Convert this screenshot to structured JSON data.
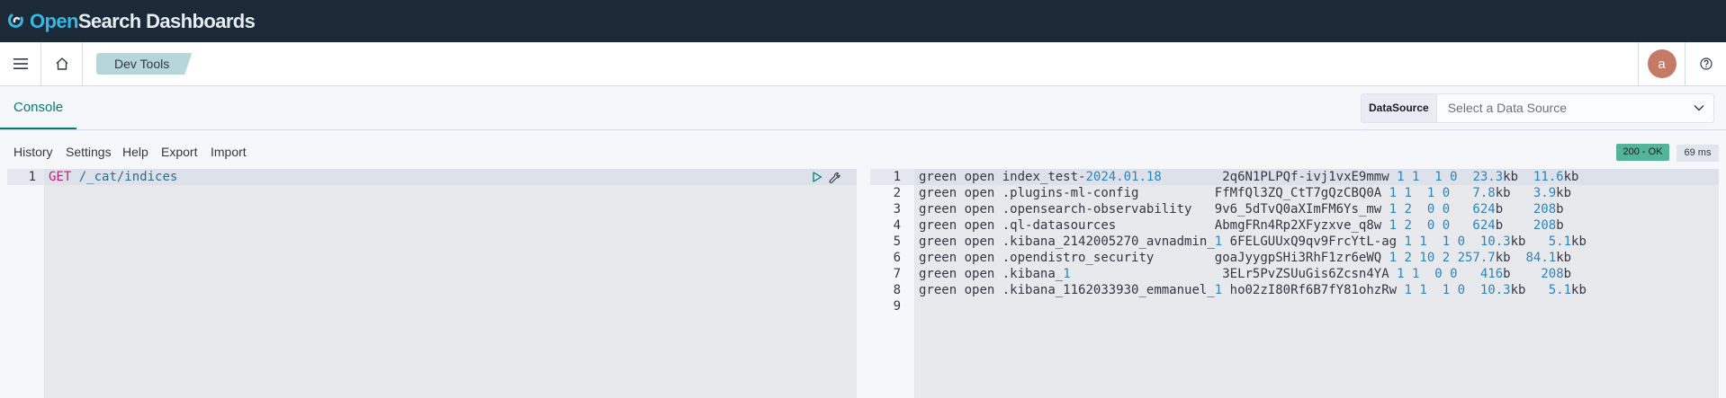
{
  "topbar": {
    "brand_open": "Open",
    "brand_rest": "Search Dashboards",
    "logo_icon": "opensearch-logo-icon"
  },
  "header": {
    "menu_icon": "hamburger-menu-icon",
    "home_icon": "home-icon",
    "breadcrumb": "Dev Tools",
    "avatar_initial": "a",
    "help_icon": "help-icon"
  },
  "console": {
    "tab_label": "Console",
    "datasource_label": "DataSource",
    "datasource_placeholder": "Select a Data Source",
    "menu": [
      "History",
      "Settings",
      "Help",
      "Export",
      "Import"
    ],
    "status_badge": "200 - OK",
    "time_badge": "69 ms",
    "status_color": "#54b399"
  },
  "request": {
    "lines": [
      {
        "num": "1",
        "method": "GET",
        "path": "/_cat/indices"
      }
    ],
    "run_icon": "play-icon",
    "settings_icon": "wrench-icon"
  },
  "response": {
    "line_numbers": [
      "1",
      "2",
      "3",
      "4",
      "5",
      "6",
      "7",
      "8",
      "9"
    ],
    "rows": [
      {
        "health": "green",
        "status": "open",
        "index": "index_test-",
        "index_num": "2024.01.18",
        "pad": "       ",
        "uuid": "2q6N1PLPQf-ivj1vxE9mmw",
        "pri": "1",
        "rep": "1",
        "docs": " 1",
        "del": "0",
        "size_a": " 23.3",
        "size_a_u": "kb",
        "size_b": " 11.6",
        "size_b_u": "kb"
      },
      {
        "health": "green",
        "status": "open",
        "index": ".plugins-ml-config",
        "index_num": "",
        "pad": "         ",
        "uuid": "FfMfQl3ZQ_CtT7gQzCBQ0A",
        "pri": "1",
        "rep": "1",
        "docs": " 1",
        "del": "0",
        "size_a": "  7.8",
        "size_a_u": "kb",
        "size_b": "  3.9",
        "size_b_u": "kb"
      },
      {
        "health": "green",
        "status": "open",
        "index": ".opensearch-observability",
        "index_num": "",
        "pad": "  ",
        "uuid": "9v6_5dTvQ0aXImFM6Ys_mw",
        "pri": "1",
        "rep": "2",
        "docs": " 0",
        "del": "0",
        "size_a": "  624",
        "size_a_u": "b",
        "size_b": "   208",
        "size_b_u": "b"
      },
      {
        "health": "green",
        "status": "open",
        "index": ".ql-datasources",
        "index_num": "",
        "pad": "            ",
        "uuid": "AbmgFRn4Rp2XFyzxve_q8w",
        "pri": "1",
        "rep": "2",
        "docs": " 0",
        "del": "0",
        "size_a": "  624",
        "size_a_u": "b",
        "size_b": "   208",
        "size_b_u": "b"
      },
      {
        "health": "green",
        "status": "open",
        "index": ".kibana_2142005270_avnadmin_",
        "index_num": "1",
        "pad": "",
        "uuid": "6FELGUUxQ9qv9FrcYtL-ag",
        "pri": "1",
        "rep": "1",
        "docs": " 1",
        "del": "0",
        "size_a": " 10.3",
        "size_a_u": "kb",
        "size_b": "  5.1",
        "size_b_u": "kb"
      },
      {
        "health": "green",
        "status": "open",
        "index": ".opendistro_security",
        "index_num": "",
        "pad": "       ",
        "uuid": "goaJyygpSHi3RhF1zr6eWQ",
        "pri": "1",
        "rep": "2",
        "docs": "10",
        "del": "2",
        "size_a": "257.7",
        "size_a_u": "kb",
        "size_b": " 84.1",
        "size_b_u": "kb"
      },
      {
        "health": "green",
        "status": "open",
        "index": ".kibana_",
        "index_num": "1",
        "pad": "                   ",
        "uuid": "3ELr5PvZSUuGis6Zcsn4YA",
        "pri": "1",
        "rep": "1",
        "docs": " 0",
        "del": "0",
        "size_a": "  416",
        "size_a_u": "b",
        "size_b": "   208",
        "size_b_u": "b"
      },
      {
        "health": "green",
        "status": "open",
        "index": ".kibana_1162033930_emmanuel_",
        "index_num": "1",
        "pad": "",
        "uuid": "ho02zI80Rf6B7fY81ohzRw",
        "pri": "1",
        "rep": "1",
        "docs": " 1",
        "del": "0",
        "size_a": " 10.3",
        "size_a_u": "kb",
        "size_b": "  5.1",
        "size_b_u": "kb"
      }
    ]
  }
}
